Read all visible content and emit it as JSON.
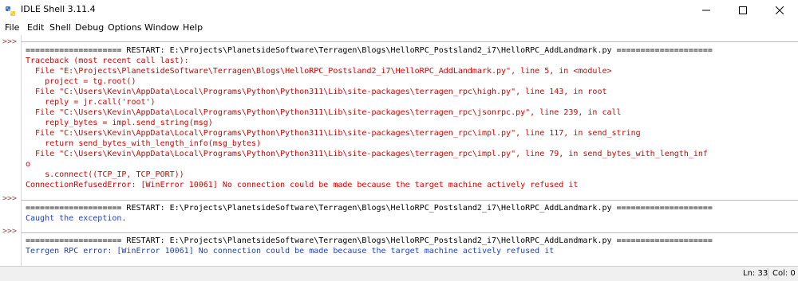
{
  "window": {
    "title": "IDLE Shell 3.11.4"
  },
  "menu": {
    "file": "File",
    "edit": "Edit",
    "shell": "Shell",
    "debug": "Debug",
    "options": "Options",
    "window": "Window",
    "help": "Help"
  },
  "prompts": [
    ">>>",
    ">>>",
    ">>>"
  ],
  "lines": [
    "==================== RESTART: E:\\Projects\\PlanetsideSoftware\\Terragen\\Blogs\\HelloRPC_Postsland2_i7\\HelloRPC_AddLandmark.py ====================",
    "Traceback (most recent call last):",
    "  File \"E:\\Projects\\PlanetsideSoftware\\Terragen\\Blogs\\HelloRPC_Postsland2_i7\\HelloRPC_AddLandmark.py\", line 5, in <module>",
    "    project = tg.root()",
    "  File \"C:\\Users\\Kevin\\AppData\\Local\\Programs\\Python\\Python311\\Lib\\site-packages\\terragen_rpc\\high.py\", line 143, in root",
    "    reply = jr.call('root')",
    "  File \"C:\\Users\\Kevin\\AppData\\Local\\Programs\\Python\\Python311\\Lib\\site-packages\\terragen_rpc\\jsonrpc.py\", line 239, in call",
    "    reply_bytes = impl.send_string(msg)",
    "  File \"C:\\Users\\Kevin\\AppData\\Local\\Programs\\Python\\Python311\\Lib\\site-packages\\terragen_rpc\\impl.py\", line 117, in send_string",
    "    return send_bytes_with_length_info(msg_bytes)",
    "  File \"C:\\Users\\Kevin\\AppData\\Local\\Programs\\Python\\Python311\\Lib\\site-packages\\terragen_rpc\\impl.py\", line 79, in send_bytes_with_length_inf",
    "o",
    "    s.connect((TCP_IP, TCP_PORT))",
    "ConnectionRefusedError: [WinError 10061] No connection could be made because the target machine actively refused it",
    "==================== RESTART: E:\\Projects\\PlanetsideSoftware\\Terragen\\Blogs\\HelloRPC_Postsland2_i7\\HelloRPC_AddLandmark.py ====================",
    "Caught the exception.",
    "==================== RESTART: E:\\Projects\\PlanetsideSoftware\\Terragen\\Blogs\\HelloRPC_Postsland2_i7\\HelloRPC_AddLandmark.py ====================",
    "Terrgen RPC error: [WinError 10061] No connection could be made because the target machine actively refused it"
  ],
  "status": {
    "line": "Ln: 33",
    "col": "Col: 0"
  },
  "colors": {
    "error": "#d40000",
    "output": "#1f3fc8",
    "prompt": "#8a4b4b"
  }
}
